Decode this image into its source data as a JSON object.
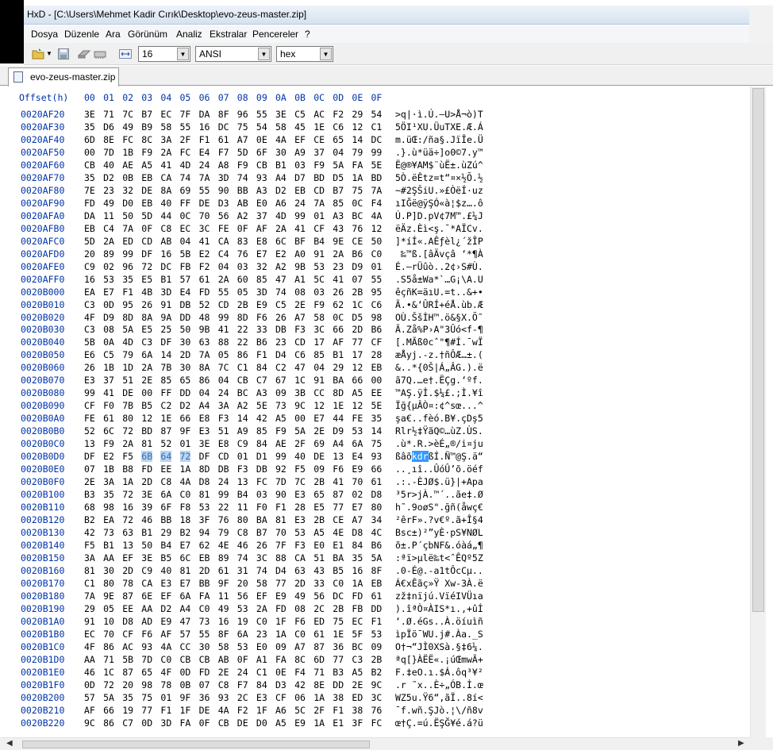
{
  "window": {
    "title": "HxD - [C:\\Users\\Mehmet Kadir Cırık\\Desktop\\evo-zeus-master.zip]"
  },
  "menu": [
    "Dosya",
    "Düzenle",
    "Ara",
    "Görünüm",
    "Analiz",
    "Ekstralar",
    "Pencereler",
    "?"
  ],
  "toolbar": {
    "bytes_per_row": "16",
    "charset": "ANSI",
    "display_mode": "hex"
  },
  "tab": {
    "label": "evo-zeus-master.zip"
  },
  "header": {
    "offset": "Offset(h)",
    "columns": [
      "00",
      "01",
      "02",
      "03",
      "04",
      "05",
      "06",
      "07",
      "08",
      "09",
      "0A",
      "0B",
      "0C",
      "0D",
      "0E",
      "0F"
    ]
  },
  "rows": [
    {
      "o": "0020AF20",
      "h": "3E 71 7C B7 EC 7F DA 8F 96 55 3E C5 AC F2 29 54",
      "a": ">q|·ì.Ú.–U>Å¬ò)T"
    },
    {
      "o": "0020AF30",
      "h": "35 D6 49 B9 58 55 16 DC 75 54 58 45 1E C6 12 C1",
      "a": "5ÖI¹XU.ÜuTXE.Æ.Á"
    },
    {
      "o": "0020AF40",
      "h": "6D 8E FC 8C 3A 2F F1 61 A7 0E 4A EF CE 65 14 DC",
      "a": "m.üŒ:/ña§.JïÎe.Ü"
    },
    {
      "o": "0020AF50",
      "h": "00 7D 1B F9 2A FC E4 F7 5D 6F 30 A9 37 04 79 99",
      "a": ".}.ù*üä÷]o0©7.y™"
    },
    {
      "o": "0020AF60",
      "h": "CB 40 AE A5 41 4D 24 A8 F9 CB B1 03 F9 5A FA 5E",
      "a": "Ë@®¥AM$¨ùË±.ùZú^"
    },
    {
      "o": "0020AF70",
      "h": "35 D2 0B EB CA 74 7A 3D 74 93 A4 D7 BD D5 1A BD",
      "a": "5Ò.ëÊtz=t“¤×½Õ.½"
    },
    {
      "o": "0020AF80",
      "h": "7E 23 32 DE 8A 69 55 90 BB A3 D2 EB CD B7 75 7A",
      "a": "~#2ŞŠiU.»£ÒëÍ·uz"
    },
    {
      "o": "0020AF90",
      "h": "FD 49 D0 EB 40 FF DE D3 AB E0 A6 24 7A 85 0C F4",
      "a": "ıIĞë@ÿŞÓ«à¦$z….ô"
    },
    {
      "o": "0020AFA0",
      "h": "DA 11 50 5D 44 0C 70 56 A2 37 4D 99 01 A3 BC 4A",
      "a": "Ú.P]D.pV¢7M™.£¼J"
    },
    {
      "o": "0020AFB0",
      "h": "EB C4 7A 0F C8 EC 3C FE 0F AF 2A 41 CF 43 76 12",
      "a": "ëÄz.Èì<ş.¯*AÏCv."
    },
    {
      "o": "0020AFC0",
      "h": "5D 2A ED CD AB 04 41 CA 83 E8 6C BF B4 9E CE 50",
      "a": "]*íÍ«.AÊƒèl¿´žÎP"
    },
    {
      "o": "0020AFD0",
      "h": "20 89 99 DF 16 5B E2 C4 76 E7 E2 A0 91 2A B6 C0",
      "a": " ‰™ß.[âÄvçâ ‘*¶À"
    },
    {
      "o": "0020AFE0",
      "h": "C9 02 96 72 DC FB F2 04 03 32 A2 9B 53 23 D9 01",
      "a": "É.–rÜûò..2¢›S#Ù."
    },
    {
      "o": "0020AFF0",
      "h": "16 53 35 E5 B1 57 61 2A 60 85 47 A1 5C 41 07 55",
      "a": ".S5å±Wa*`…G¡\\A.U"
    },
    {
      "o": "0020B000",
      "h": "EA E7 F1 4B 3D E4 FD 55 05 3D 74 08 03 26 2B 95",
      "a": "êçñK=äıU.=t..&+•"
    },
    {
      "o": "0020B010",
      "h": "C3 0D 95 26 91 DB 52 CD 2B E9 C5 2E F9 62 1C C6",
      "a": "Ã.•&‘ÛRÍ+éÅ.ùb.Æ"
    },
    {
      "o": "0020B020",
      "h": "4F D9 8D 8A 9A DD 48 99 8D F6 26 A7 58 0C D5 98",
      "a": "OÙ.ŠšİH™.ö&§X.Õ˜"
    },
    {
      "o": "0020B030",
      "h": "C3 08 5A E5 25 50 9B 41 22 33 DB F3 3C 66 2D B6",
      "a": "Ã.Zå%P›A\"3Ûó<f-¶"
    },
    {
      "o": "0020B040",
      "h": "5B 0A 4D C3 DF 30 63 88 22 B6 23 CD 17 AF 77 CF",
      "a": "[.MÃß0cˆ\"¶#Í.¯wÏ"
    },
    {
      "o": "0020B050",
      "h": "E6 C5 79 6A 14 2D 7A 05 86 F1 D4 C6 85 B1 17 28",
      "a": "æÅyj.-z.†ñÔÆ…±.("
    },
    {
      "o": "0020B060",
      "h": "26 1B 1D 2A 7B 30 8A 7C C1 84 C2 47 04 29 12 EB",
      "a": "&..*{0Š|Á„ÂG.).ë"
    },
    {
      "o": "0020B070",
      "h": "E3 37 51 2E 85 65 86 04 CB C7 67 1C 91 BA 66 00",
      "a": "ã7Q.…e†.ËÇg.‘ºf."
    },
    {
      "o": "0020B080",
      "h": "99 41 DE 00 FF DD 04 24 BC A3 09 3B CC 8D A5 EE",
      "a": "™AŞ.ÿİ.$¼£.;Ì.¥î"
    },
    {
      "o": "0020B090",
      "h": "CF F0 7B B5 C2 D2 A4 3A A2 5E 73 9C 12 1E 12 5E",
      "a": "Ïğ{µÂÒ¤:¢^sœ...^"
    },
    {
      "o": "0020B0A0",
      "h": "FE 61 80 12 1E 66 E8 F3 14 42 A5 00 E7 44 FE 35",
      "a": "şa€..fèó.B¥.çDş5"
    },
    {
      "o": "0020B0B0",
      "h": "52 6C 72 BD 87 9F E3 51 A9 85 F9 5A 2E D9 53 14",
      "a": "Rlr½‡ŸãQ©…ùZ.ÙS."
    },
    {
      "o": "0020B0C0",
      "h": "13 F9 2A 81 52 01 3E E8 C9 84 AE 2F 69 A4 6A 75",
      "a": ".ù*.R.>èÉ„®/i¤ju"
    },
    {
      "o": "0020B0D0",
      "h": "DF E2 F5 6B 64 72 DF CD 01 D1 99 40 DE 13 E4 93",
      "a": "ßâõkdrßÍ.Ñ™@Ş.ä“",
      "hsel": [
        3,
        4,
        5
      ],
      "apre": "ßâõ",
      "asel": "kdr",
      "apost": "ßÍ.Ñ™@Ş.ä“"
    },
    {
      "o": "0020B0E0",
      "h": "07 1B B8 FD EE 1A 8D DB F3 DB 92 F5 09 F6 E9 66",
      "a": "..¸ıî..ÛóÛ’õ.öéf"
    },
    {
      "o": "0020B0F0",
      "h": "2E 3A 1A 2D C8 4A D8 24 13 FC 7D 7C 2B 41 70 61",
      "a": ".:.-ÈJØ$.ü}|+Apa"
    },
    {
      "o": "0020B100",
      "h": "B3 35 72 3E 6A C0 81 99 B4 03 90 E3 65 87 02 D8",
      "a": "³5r>jÀ.™´..ãe‡.Ø"
    },
    {
      "o": "0020B110",
      "h": "68 98 16 39 6F F8 53 22 11 F0 F1 28 E5 77 E7 80",
      "a": "h˜.9oøS\".ğñ(åwç€"
    },
    {
      "o": "0020B120",
      "h": "B2 EA 72 46 BB 18 3F 76 80 BA 81 E3 2B CE A7 34",
      "a": "²êrF».?v€º.ã+Î§4"
    },
    {
      "o": "0020B130",
      "h": "42 73 63 B1 29 B2 94 79 C8 B7 70 53 A5 4E D8 4C",
      "a": "Bsc±)²”yÈ·pS¥NØL"
    },
    {
      "o": "0020B140",
      "h": "F5 B1 13 50 B4 E7 62 4E 46 26 7F F3 E0 E1 84 B6",
      "a": "õ±.P´çbNF&.óàá„¶"
    },
    {
      "o": "0020B150",
      "h": "3A AA EF 3E B5 6C EB 89 74 3C 88 CA 51 BA 35 5A",
      "a": ":ªï>µlë‰t<ˆÊQº5Z"
    },
    {
      "o": "0020B160",
      "h": "81 30 2D C9 40 81 2D 61 31 74 D4 63 43 B5 16 8F",
      "a": ".0-É@.-a1tÔcCµ.."
    },
    {
      "o": "0020B170",
      "h": "C1 80 78 CA E3 E7 BB 9F 20 58 77 2D 33 C0 1A EB",
      "a": "Á€xÊãç»Ÿ Xw-3À.ë"
    },
    {
      "o": "0020B180",
      "h": "7A 9E 87 6E EF 6A FA 11 56 EF E9 49 56 DC FD 61",
      "a": "zž‡nïjú.VïéIVÜıa"
    },
    {
      "o": "0020B190",
      "h": "29 05 EE AA D2 A4 C0 49 53 2A FD 08 2C 2B FB DD",
      "a": ").îªÒ¤ÀIS*ı.,+ûİ"
    },
    {
      "o": "0020B1A0",
      "h": "91 10 D8 AD E9 47 73 16 19 C0 1F F6 ED 75 EC F1",
      "a": "‘.Ø.éGs..À.öíuìñ"
    },
    {
      "o": "0020B1B0",
      "h": "EC 70 CF F6 AF 57 55 8F 6A 23 1A C0 61 1E 5F 53",
      "a": "ìpÏö¯WU.j#.Àa._S"
    },
    {
      "o": "0020B1C0",
      "h": "4F 86 AC 93 4A CC 30 58 53 E0 09 A7 87 36 BC 09",
      "a": "O†¬“JÌ0XSà.§‡6¼."
    },
    {
      "o": "0020B1D0",
      "h": "AA 71 5B 7D C0 CB CB AB 0F A1 FA 8C 6D 77 C3 2B",
      "a": "ªq[}ÀËË«.¡úŒmwÃ+"
    },
    {
      "o": "0020B1E0",
      "h": "46 1C 87 65 4F 0D FD 2E 24 C1 0E F4 71 B3 A5 B2",
      "a": "F.‡eO.ı.$Á.ôq³¥²"
    },
    {
      "o": "0020B1F0",
      "h": "0D 72 20 98 78 0B 07 C8 F7 84 D3 42 8E DD 2E 9C",
      "a": ".r ˜x..È÷„ÓB.İ.œ"
    },
    {
      "o": "0020B200",
      "h": "57 5A 35 75 01 9F 36 93 2C E3 CF 06 1A 38 ED 3C",
      "a": "WZ5u.Ÿ6“,ãÏ..8í<"
    },
    {
      "o": "0020B210",
      "h": "AF 66 19 77 F1 1F DE 4A F2 1F A6 5C 2F F1 38 76",
      "a": "¯f.wñ.ŞJò.¦\\/ñ8v"
    },
    {
      "o": "0020B220",
      "h": "9C 86 C7 0D 3D FA 0F CB DE D0 A5 E9 1A E1 3F FC",
      "a": "œ†Ç.=ú.ËŞĞ¥é.á?ü"
    }
  ]
}
